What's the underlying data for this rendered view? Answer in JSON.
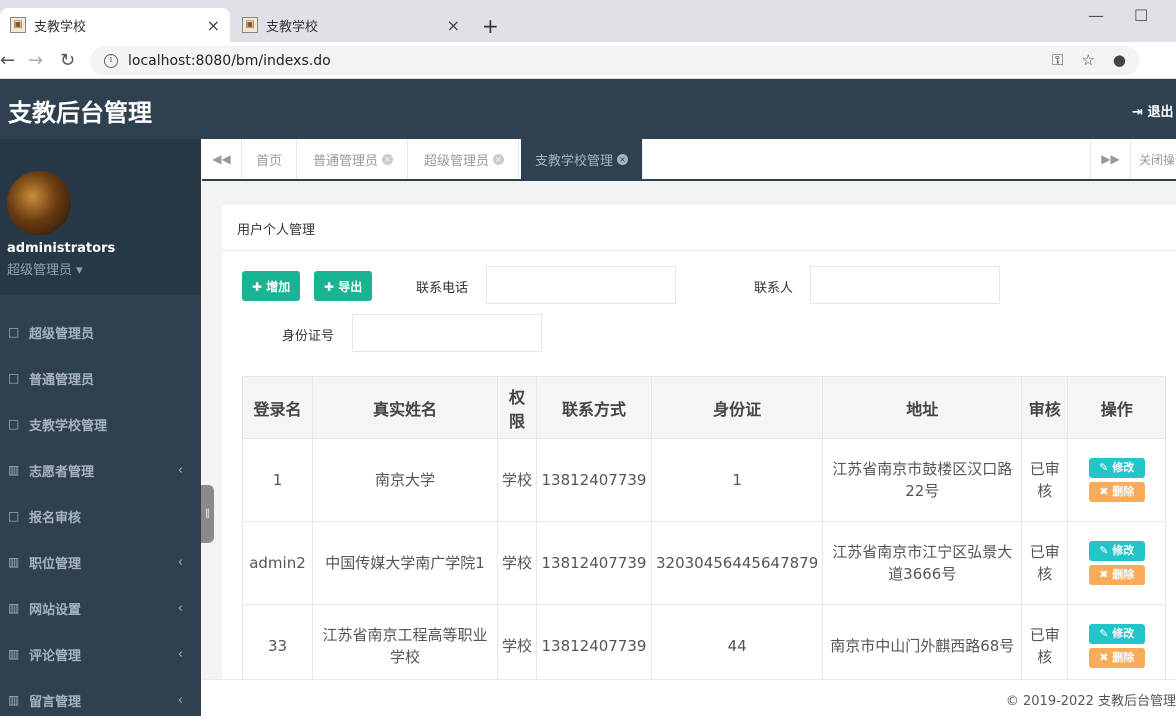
{
  "browser": {
    "tabs": [
      {
        "title": "支教学校",
        "close": "×"
      },
      {
        "title": "支教学校",
        "close": "×"
      }
    ],
    "new_tab": "+",
    "url": "localhost:8080/bm/indexs.do",
    "window_controls": {
      "minimize": "—",
      "maximize": "☐"
    },
    "nav": {
      "back": "←",
      "forward": "→",
      "reload": "↻"
    },
    "omni_icons": {
      "key": "⚿",
      "star": "☆",
      "account": "●"
    }
  },
  "header": {
    "title": "支教后台管理",
    "logout_label": "退出"
  },
  "sidebar": {
    "user_name": "administrators",
    "user_role": "超级管理员 ▾",
    "items": [
      {
        "label": "超级管理员",
        "icon": "□",
        "has_arrow": false
      },
      {
        "label": "普通管理员",
        "icon": "□",
        "has_arrow": false
      },
      {
        "label": "支教学校管理",
        "icon": "□",
        "has_arrow": false
      },
      {
        "label": "志愿者管理",
        "icon": "▥",
        "has_arrow": true
      },
      {
        "label": "报名审核",
        "icon": "□",
        "has_arrow": false
      },
      {
        "label": "职位管理",
        "icon": "▥",
        "has_arrow": true
      },
      {
        "label": "网站设置",
        "icon": "▥",
        "has_arrow": true
      },
      {
        "label": "评论管理",
        "icon": "▥",
        "has_arrow": true
      },
      {
        "label": "留言管理",
        "icon": "▥",
        "has_arrow": true
      }
    ],
    "arrow": "‹",
    "collapse_handle": "‖"
  },
  "content_tabs": {
    "prev": "◀◀",
    "next": "▶▶",
    "items": [
      {
        "label": "首页",
        "closable": false
      },
      {
        "label": "普通管理员",
        "closable": true
      },
      {
        "label": "超级管理员",
        "closable": true
      },
      {
        "label": "支教学校管理",
        "closable": true
      }
    ],
    "close_x": "×",
    "close_ops": "关闭操作"
  },
  "panel": {
    "title": "用户个人管理",
    "add_button": "✚ 增加",
    "export_button": "✚ 导出",
    "filters": {
      "phone_label": "联系电话",
      "contact_label": "联系人",
      "idcard_label": "身份证号"
    }
  },
  "table": {
    "headers": [
      "登录名",
      "真实姓名",
      "权限",
      "联系方式",
      "身份证",
      "地址",
      "审核",
      "操作"
    ],
    "rows": [
      {
        "login": "1",
        "name": "南京大学",
        "role": "学校",
        "phone": "13812407739",
        "idcard": "1",
        "address": "江苏省南京市鼓楼区汉口路22号",
        "audit": "已审核"
      },
      {
        "login": "admin2",
        "name": "中国传媒大学南广学院1",
        "role": "学校",
        "phone": "13812407739",
        "idcard": "32030456445647879",
        "address": "江苏省南京市江宁区弘景大道3666号",
        "audit": "已审核"
      },
      {
        "login": "33",
        "name": "江苏省南京工程高等职业学校",
        "role": "学校",
        "phone": "13812407739",
        "idcard": "44",
        "address": "南京市中山门外麒西路68号",
        "audit": "已审核"
      }
    ],
    "edit_label": "✎ 修改",
    "delete_label": "✖ 删除"
  },
  "footer": {
    "text": "© 2019-2022 支教后台管理"
  },
  "colors": {
    "sidebar_bg": "#2f4050",
    "accent_green": "#1ab394",
    "edit_cyan": "#23c6c8",
    "delete_orange": "#f8ac59"
  }
}
